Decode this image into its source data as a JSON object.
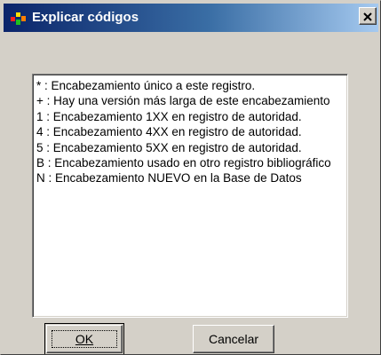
{
  "window": {
    "title": "Explicar códigos",
    "title_color": "#ffffff",
    "titlebar_gradient": [
      "#0a246a",
      "#a6caf0"
    ],
    "app_icon": "app-icon",
    "close_icon": "close-icon"
  },
  "list": {
    "items": [
      "* : Encabezamiento único a este registro.",
      "+ : Hay una versión más larga de este encabezamiento",
      "1 : Encabezamiento 1XX en registro de autoridad.",
      "4 : Encabezamiento 4XX en registro de autoridad.",
      "5 : Encabezamiento 5XX en registro de autoridad.",
      "B : Encabezamiento usado en otro registro bibliográfico",
      "N : Encabezamiento NUEVO en la Base de Datos"
    ]
  },
  "buttons": {
    "ok_label": "OK",
    "cancel_label": "Cancelar"
  },
  "colors": {
    "dialog_face": "#d4d0c8",
    "list_background": "#ffffff"
  }
}
